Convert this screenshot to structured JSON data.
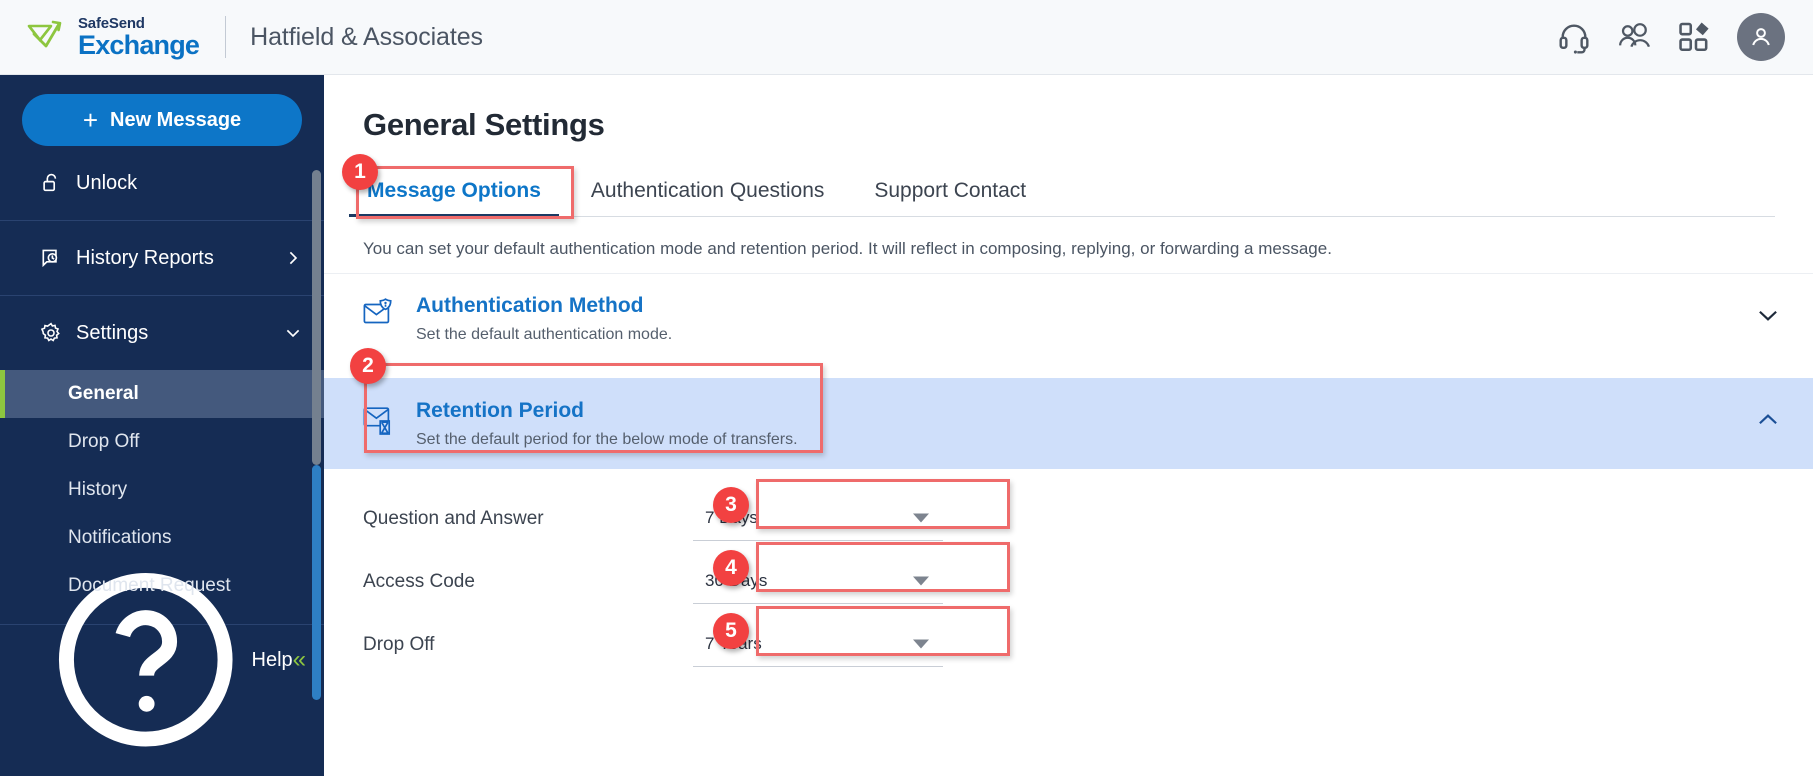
{
  "header": {
    "brand_top": "SafeSend",
    "brand_bottom": "Exchange",
    "org_name": "Hatfield & Associates",
    "icons": [
      {
        "name": "headset-icon",
        "label": "Support"
      },
      {
        "name": "people-icon",
        "label": "Contacts"
      },
      {
        "name": "apps-grid-icon",
        "label": "Apps"
      },
      {
        "name": "avatar-icon",
        "label": "Account"
      }
    ]
  },
  "sidebar": {
    "new_message": "New Message",
    "new_message_plus": "+",
    "items": [
      {
        "label": "Unlock",
        "icon": "unlock-icon",
        "chevron": ""
      },
      {
        "label": "History Reports",
        "icon": "history-report-icon",
        "chevron": "right"
      },
      {
        "label": "Settings",
        "icon": "gear-icon",
        "chevron": "down"
      }
    ],
    "settings_children": [
      {
        "label": "General",
        "active": true
      },
      {
        "label": "Drop Off",
        "active": false
      },
      {
        "label": "History",
        "active": false
      },
      {
        "label": "Notifications",
        "active": false
      },
      {
        "label": "Document Request",
        "active": false
      }
    ],
    "help": {
      "label": "Help",
      "icon": "question-circle-icon"
    },
    "collapse_glyph": "«"
  },
  "main": {
    "page_title": "General Settings",
    "tabs": [
      {
        "label": "Message Options",
        "active": true
      },
      {
        "label": "Authentication Questions",
        "active": false
      },
      {
        "label": "Support Contact",
        "active": false
      }
    ],
    "description": "You can set your default authentication mode and retention period. It will reflect in composing, replying, or forwarding a message.",
    "sections": [
      {
        "title": "Authentication Method",
        "subtitle": "Set the default authentication mode.",
        "icon": "envelope-shield-icon",
        "expanded": false,
        "chevron": "down"
      },
      {
        "title": "Retention Period",
        "subtitle": "Set the default period for the below mode of transfers.",
        "icon": "envelope-hourglass-icon",
        "expanded": true,
        "chevron": "up"
      }
    ],
    "retention_fields": [
      {
        "label": "Question and Answer",
        "value": "7 Days"
      },
      {
        "label": "Access Code",
        "value": "30 Days"
      },
      {
        "label": "Drop Off",
        "value": "7 Years"
      }
    ]
  },
  "annotations": [
    {
      "number": "1",
      "target": "tab-message-options"
    },
    {
      "number": "2",
      "target": "section-retention-period"
    },
    {
      "number": "3",
      "target": "select-question-and-answer"
    },
    {
      "number": "4",
      "target": "select-access-code"
    },
    {
      "number": "5",
      "target": "select-drop-off"
    }
  ],
  "colors": {
    "brand_blue": "#0d76c8",
    "sidebar_navy": "#152c54",
    "accent_green": "#8dc63f",
    "annotation_red": "#f24141",
    "highlight_blue": "#cfdffa"
  }
}
